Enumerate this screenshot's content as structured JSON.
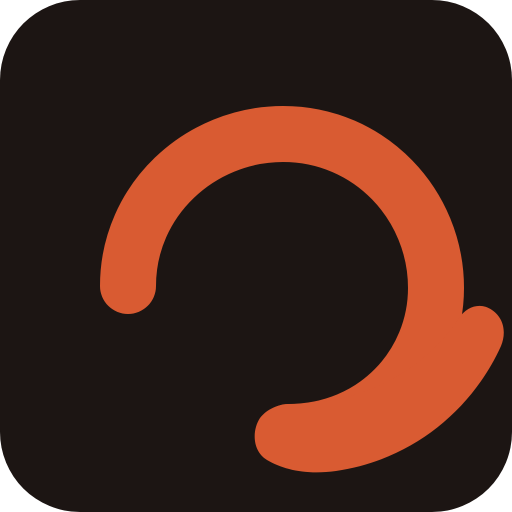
{
  "icon": {
    "name": "refresh-arrow-icon",
    "background_color": "#1c1513",
    "symbol_color": "#d95b32"
  }
}
